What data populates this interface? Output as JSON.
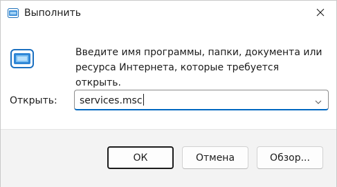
{
  "window": {
    "title": "Выполнить",
    "title_icon": "run-dialog-icon",
    "close_icon": "close-icon"
  },
  "body": {
    "icon": "run-icon",
    "description": "Введите имя программы, папки, документа или ресурса Интернета, которые требуется открыть.",
    "open_label": "Открыть:",
    "open_value": "services.msc",
    "dropdown_icon": "chevron-down-icon"
  },
  "buttons": {
    "ok": "ОК",
    "cancel": "Отмена",
    "browse": "Обзор..."
  },
  "colors": {
    "accent": "#0067c0",
    "footer_bg": "#f3f3f3"
  }
}
